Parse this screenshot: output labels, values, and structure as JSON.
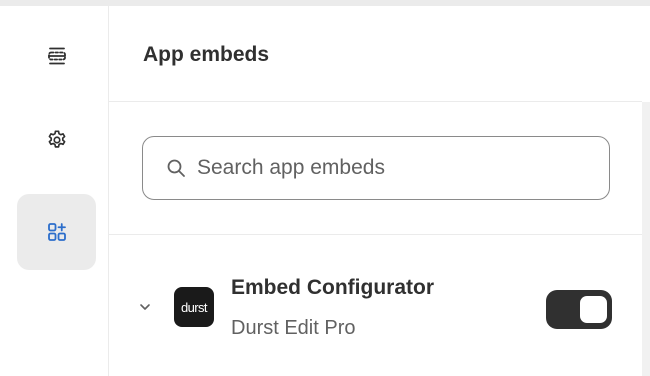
{
  "rail": {
    "items": [
      {
        "name": "sections",
        "icon": "sections-icon",
        "active": false
      },
      {
        "name": "settings",
        "icon": "gear-icon",
        "active": false
      },
      {
        "name": "app-embeds",
        "icon": "apps-add-icon",
        "active": true
      }
    ]
  },
  "panel": {
    "title": "App embeds"
  },
  "search": {
    "placeholder": "Search app embeds",
    "value": ""
  },
  "embed": {
    "name": "Embed Configurator",
    "app": "Durst Edit Pro",
    "logo_text": "durst",
    "enabled": true
  },
  "colors": {
    "toggle_on": "#303030",
    "active_rail_bg": "#ebebeb",
    "border": "#ebebeb"
  }
}
